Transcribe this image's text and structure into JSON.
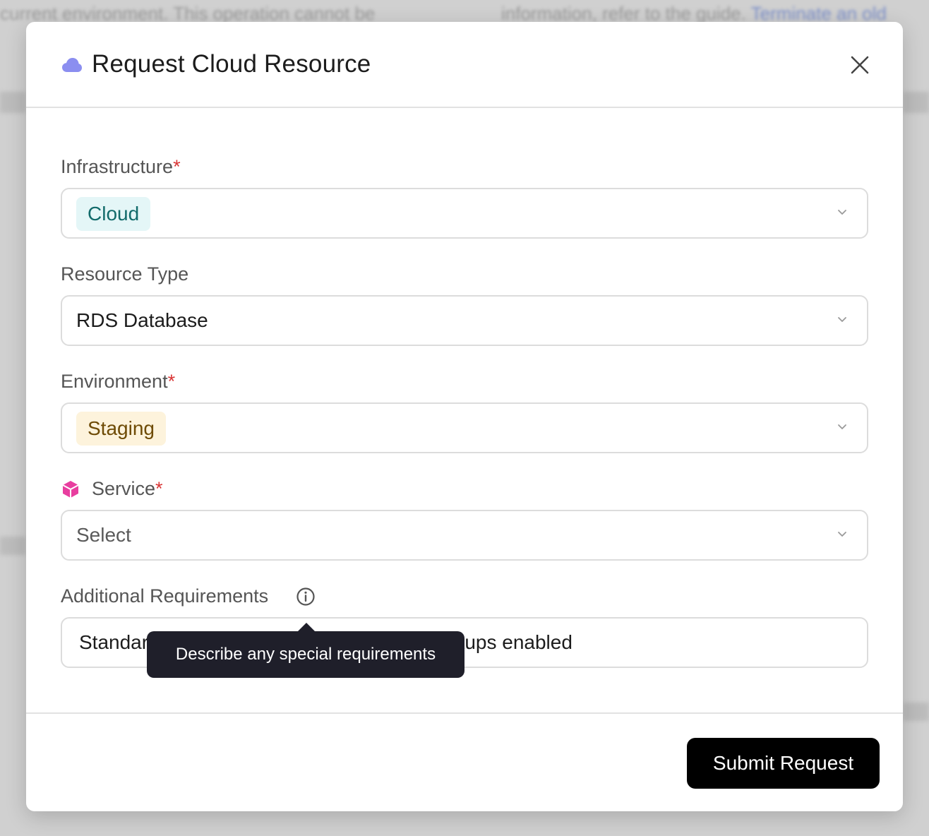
{
  "background": {
    "text_left": "current environment. This operation cannot be",
    "text_right": "information, refer to the guide.",
    "text_right_link": "Terminate an old"
  },
  "modal": {
    "title": "Request Cloud Resource",
    "title_icon": "cloud-icon",
    "close_icon": "close-icon"
  },
  "form": {
    "infrastructure": {
      "label": "Infrastructure",
      "required": "*",
      "value": "Cloud"
    },
    "resource_type": {
      "label": "Resource Type",
      "value": "RDS Database"
    },
    "environment": {
      "label": "Environment",
      "required": "*",
      "value": "Staging"
    },
    "service": {
      "label": "Service",
      "required": "*",
      "placeholder": "Select",
      "icon": "cube-icon"
    },
    "additional_requirements": {
      "label": "Additional Requirements",
      "value": "Standard configuration with automated backups enabled",
      "tooltip": "Describe any special requirements"
    }
  },
  "footer": {
    "submit_label": "Submit Request"
  },
  "colors": {
    "accent_cloud_icon": "#8b8ef0",
    "service_icon": "#e83e9f",
    "required": "#d93636",
    "tag_cloud_bg": "#e4f6f7",
    "tag_staging_bg": "#fdf3dc",
    "button_bg": "#000000"
  }
}
